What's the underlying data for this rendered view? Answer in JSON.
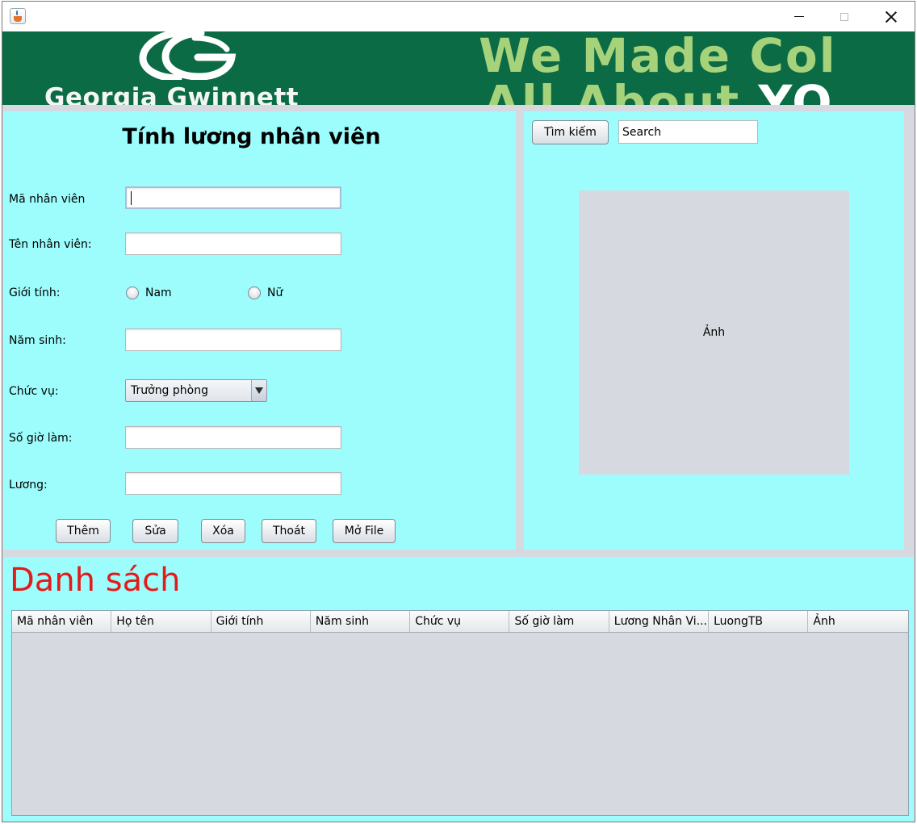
{
  "window": {
    "icon": "java-cup-icon",
    "controls": [
      "minimize",
      "maximize",
      "close"
    ]
  },
  "banner": {
    "logo_text": "Georgia Gwinnett",
    "slogan_line1": "We Made Col",
    "slogan_line2_a": "All About ",
    "slogan_line2_b": "YO"
  },
  "form": {
    "title": "Tính lương nhân viên",
    "labels": {
      "employee_id": "Mã nhân viên",
      "employee_name": "Tên nhân viên:",
      "gender": "Giới tính:",
      "birth_year": "Năm sinh:",
      "position": "Chức vụ:",
      "hours": "Số  giờ làm:",
      "salary": "Lương:"
    },
    "values": {
      "employee_id": "",
      "employee_name": "",
      "birth_year": "",
      "hours": "",
      "salary": ""
    },
    "gender_options": [
      "Nam",
      "Nữ"
    ],
    "position_selected": "Trưởng phòng",
    "buttons": [
      "Thêm",
      "Sửa",
      "Xóa",
      "Thoát",
      "Mở File"
    ]
  },
  "search": {
    "button_label": "Tìm kiếm",
    "input_value": "Search"
  },
  "image_box": {
    "label": "Ảnh"
  },
  "list": {
    "title": "Danh sách",
    "columns": [
      "Mã nhân viên",
      "Họ tên",
      "Giới tính",
      "Năm sinh",
      "Chức vụ",
      "Số giờ làm",
      "Lương Nhân Vi...",
      "LuongTB",
      "Ảnh"
    ],
    "rows": []
  },
  "colors": {
    "panel_bg": "#9cfdfc",
    "banner_bg": "#0b6b45",
    "banner_text": "#a7d27c",
    "list_title": "#e31b1b",
    "frame_bg": "#d6d9df"
  }
}
